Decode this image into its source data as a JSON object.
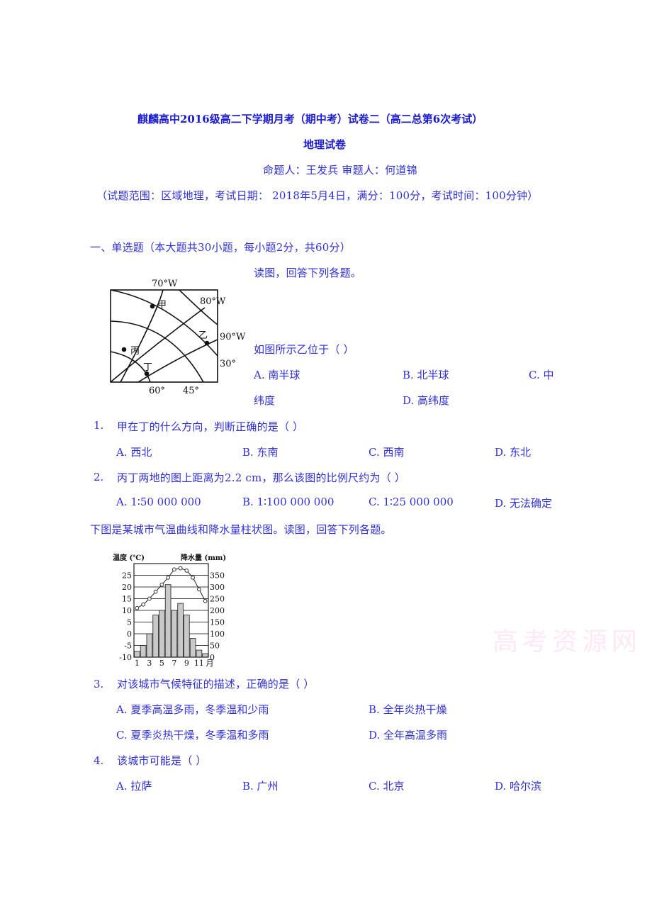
{
  "header": {
    "title": "麒麟高中2016级高二下学期月考（期中考）试卷二（高二总第6次考试）",
    "subject": "地理试卷",
    "authors": "命题人：王发兵  审题人：何道锦",
    "info": "（试题范围：区域地理，考试日期： 2018年5月4日，满分：100分，考试时间：100分钟）"
  },
  "section": {
    "heading": "一、单选题（本大题共30小题，每小题2分，共60分）"
  },
  "group1": {
    "intro": "读图，回答下列各题。",
    "map": {
      "labels": {
        "lon70": "70°W",
        "lon80": "80°W",
        "lon90": "90°W",
        "lat30": "30°",
        "lat60": "60°",
        "lat45": "45°",
        "jia": "甲",
        "yi": "乙",
        "bing": "丙",
        "ding": "丁"
      }
    },
    "q0": {
      "stem": "如图所示乙位于（ ）",
      "options": [
        "A. 南半球",
        "B. 北半球",
        "C. 中",
        "纬度",
        "D. 高纬度"
      ]
    },
    "q1": {
      "number": "1.",
      "stem": "甲在丁的什么方向，判断正确的是（ ）",
      "options": [
        "A. 西北",
        "B. 东南",
        "C. 西南",
        "D. 东北"
      ]
    },
    "q2": {
      "number": "2.",
      "stem": "丙丁两地的图上距离为2.2 cm，那么该图的比例尺约为（ ）",
      "options": [
        "A. 1∶50 000 000",
        "B. 1∶100 000 000",
        "C. 1∶25 000 000",
        "D. 无法确定"
      ]
    }
  },
  "group2": {
    "intro": "下图是某城市气温曲线和降水量柱状图。读图，回答下列各题。",
    "q3": {
      "number": "3.",
      "stem": "对该城市气候特征的描述，正确的是（ ）",
      "options": [
        "A. 夏季高温多雨，冬季温和少雨",
        "B. 全年炎热干燥",
        "C. 夏季炎热干燥，冬季温和多雨",
        "D. 全年高温多雨"
      ]
    },
    "q4": {
      "number": "4.",
      "stem": "该城市可能是（ ）",
      "options": [
        "A. 拉萨",
        "B. 广州",
        "C. 北京",
        "D. 哈尔滨"
      ]
    }
  },
  "watermark": "高考资源网",
  "chart_data": {
    "type": "bar",
    "title": "",
    "xlabel": "月",
    "ylabel": "温度 (℃)",
    "y2label": "降水量 (mm)",
    "categories": [
      "1",
      "2",
      "3",
      "4",
      "5",
      "6",
      "7",
      "8",
      "9",
      "10",
      "11",
      "12"
    ],
    "x_tick_labels": [
      "1",
      "3",
      "5",
      "7",
      "9",
      "11",
      "月"
    ],
    "ylim": [
      -10,
      30
    ],
    "y2lim": [
      0,
      400
    ],
    "y_ticks": [
      "25",
      "20",
      "15",
      "10",
      "5",
      "0",
      "-5",
      "-10"
    ],
    "y2_ticks": [
      "350",
      "300",
      "250",
      "200",
      "150",
      "100",
      "50",
      "0"
    ],
    "grid": true,
    "series": [
      {
        "name": "降水量",
        "type": "bar",
        "axis": "right",
        "values": [
          25,
          50,
          100,
          180,
          200,
          310,
          200,
          230,
          180,
          80,
          30,
          15
        ]
      },
      {
        "name": "气温",
        "type": "line",
        "axis": "left",
        "values": [
          11,
          12.5,
          15,
          18,
          21,
          24,
          27.5,
          28,
          27,
          24,
          19,
          14
        ]
      }
    ]
  }
}
